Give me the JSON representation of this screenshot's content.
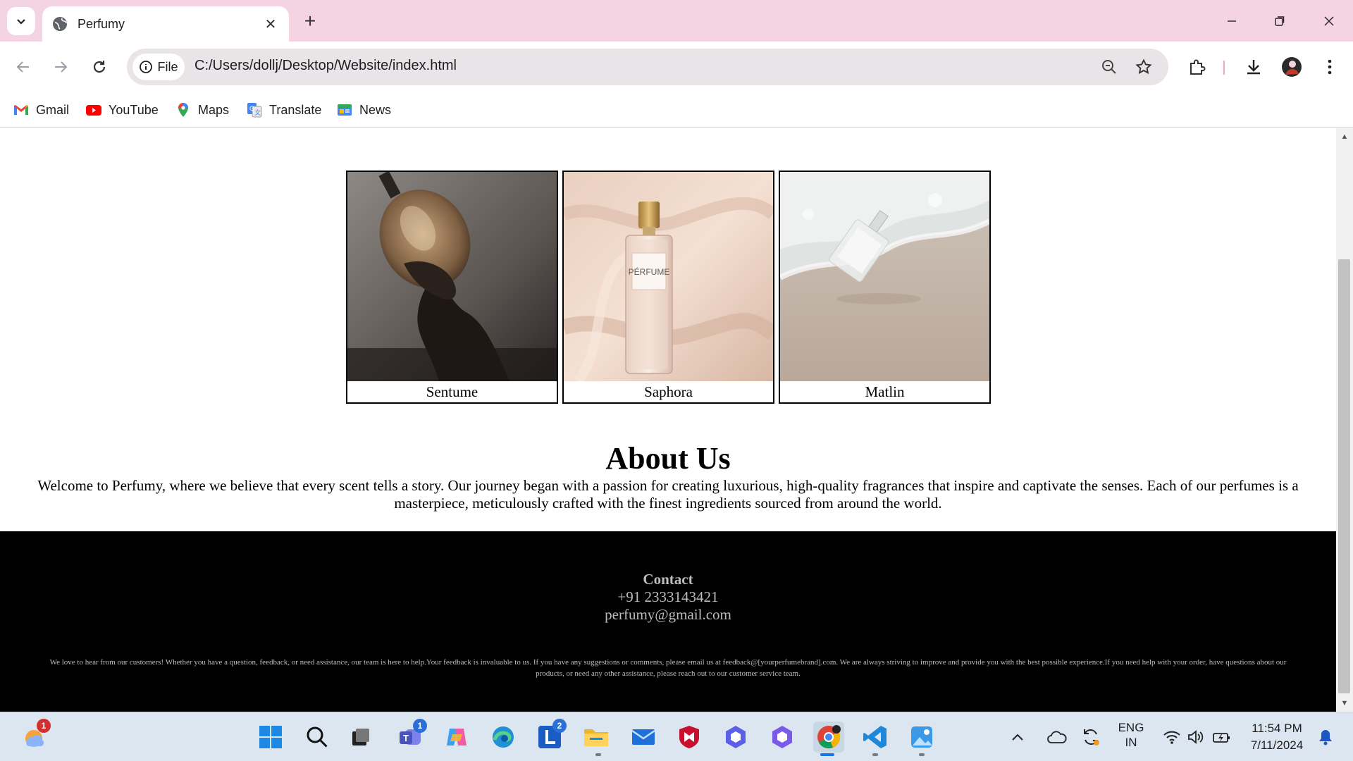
{
  "browser": {
    "tab_title": "Perfumy",
    "url_chip": "File",
    "url": "C:/Users/dollj/Desktop/Website/index.html",
    "bookmarks": [
      {
        "label": "Gmail",
        "icon": "gmail-icon"
      },
      {
        "label": "YouTube",
        "icon": "youtube-icon"
      },
      {
        "label": "Maps",
        "icon": "maps-icon"
      },
      {
        "label": "Translate",
        "icon": "translate-icon"
      },
      {
        "label": "News",
        "icon": "news-icon"
      }
    ]
  },
  "page": {
    "products": [
      {
        "name": "Sentume",
        "image": "perfume-bottle-hand-photo"
      },
      {
        "name": "Saphora",
        "image": "perfume-bottle-silk-photo",
        "bottle_label": "PÉRFUME"
      },
      {
        "name": "Matlin",
        "image": "perfume-bottle-beach-photo"
      }
    ],
    "about": {
      "title": "About Us",
      "text": "Welcome to Perfumy, where we believe that every scent tells a story. Our journey began with a passion for creating luxurious, high-quality fragrances that inspire and captivate the senses. Each of our perfumes is a masterpiece, meticulously crafted with the finest ingredients sourced from around the world."
    },
    "footer": {
      "heading": "Contact",
      "phone": "+91 2333143421",
      "email": "perfumy@gmail.com",
      "fine_print": "We love to hear from our customers! Whether you have a question, feedback, or need assistance, our team is here to help.Your feedback is invaluable to us. If you have any suggestions or comments, please email us at feedback@[yourperfumebrand].com. We are always striving to improve and provide you with the best possible experience.If you need help with your order, have questions about our products, or need any other assistance, please reach out to our customer service team."
    }
  },
  "taskbar": {
    "weather_badge": "1",
    "teams_badge": "1",
    "l_badge": "2",
    "language": "ENG",
    "region": "IN",
    "time": "11:54 PM",
    "date": "7/11/2024"
  },
  "colors": {
    "titlebar": "#f4d3e2",
    "footer_bg": "#000000",
    "footer_text": "#bdbdbd"
  }
}
